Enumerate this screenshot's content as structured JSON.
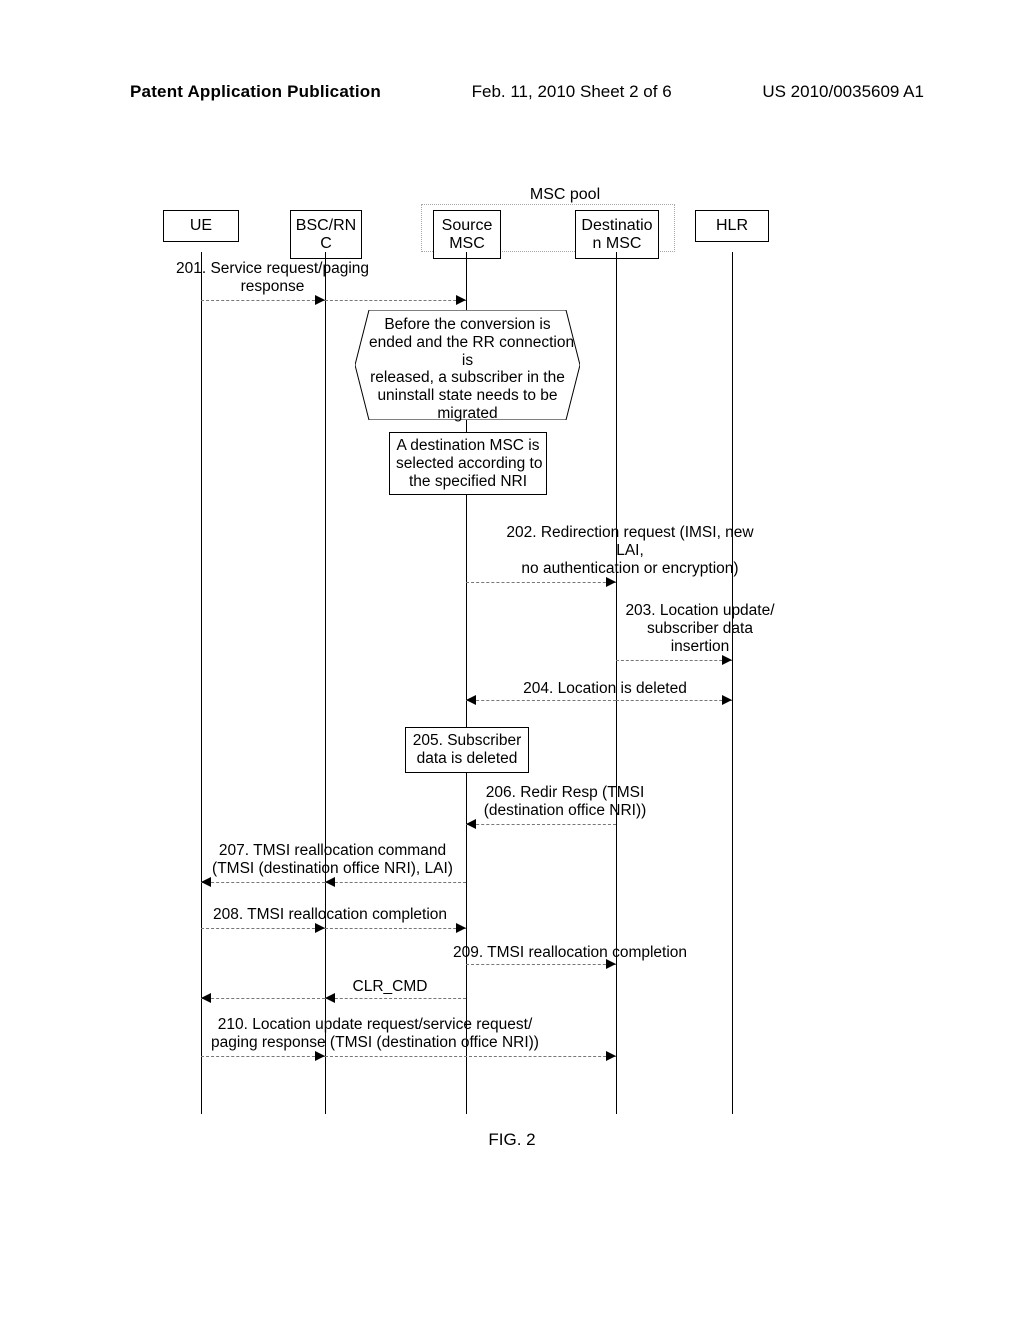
{
  "header": {
    "left": "Patent Application Publication",
    "center": "Feb. 11, 2010  Sheet 2 of 6",
    "right": "US 2010/0035609 A1"
  },
  "participants": {
    "ue": "UE",
    "bsc": "BSC/RN\nC",
    "src": "Source\nMSC",
    "dst": "Destinatio\nn MSC",
    "hlr": "HLR"
  },
  "pool_label": "MSC pool",
  "notes": {
    "hex": "Before the conversion is\nended and the RR connection\nis\nreleased, a subscriber in the\nuninstall state needs to be\nmigrated",
    "select": "A destination MSC is\nselected according to\nthe specified NRI",
    "sub_del": "205. Subscriber\ndata is deleted"
  },
  "messages": {
    "m201": "201. Service request/paging\nresponse",
    "m202": "202. Redirection request (IMSI, new\nLAI,\nno authentication or encryption)",
    "m203": "203. Location update/\nsubscriber data\ninsertion",
    "m204": "204. Location is deleted",
    "m206": "206. Redir Resp (TMSI\n(destination office NRI))",
    "m207": "207. TMSI reallocation command\n(TMSI (destination office NRI), LAI)",
    "m208": "208. TMSI reallocation completion",
    "m209": "209. TMSI reallocation completion",
    "clr": "CLR_CMD",
    "m210": "210. Location update request/service request/\npaging response (TMSI (destination office NRI))"
  },
  "figure_caption": "FIG. 2",
  "lifeline_x": {
    "ue": 56,
    "bsc": 180,
    "src": 321,
    "dst": 471,
    "hlr": 587
  }
}
